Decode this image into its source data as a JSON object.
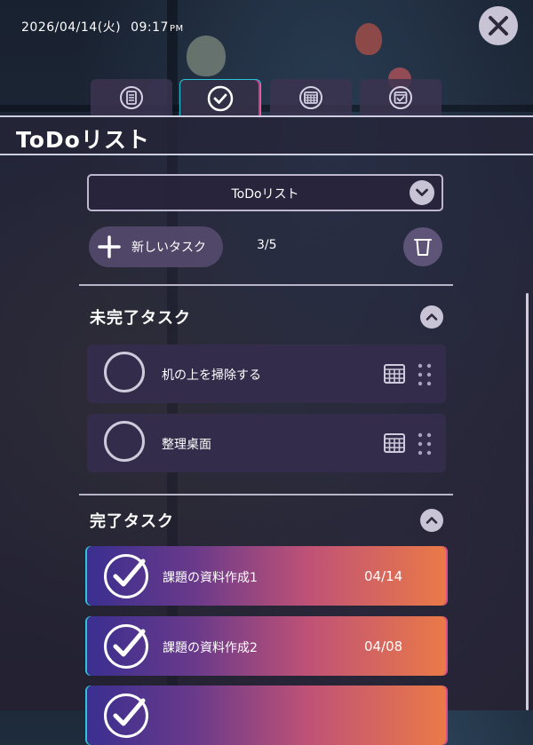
{
  "status_bar": {
    "date": "2026/04/14(火)",
    "time": "09:17",
    "meridiem": "PM"
  },
  "close_icon": "close-icon",
  "tabs": [
    {
      "icon": "list-icon",
      "active": false
    },
    {
      "icon": "check-circle-icon",
      "active": true
    },
    {
      "icon": "calendar-icon",
      "active": false
    },
    {
      "icon": "calendar-check-icon",
      "active": false
    }
  ],
  "page_title": "ToDoリスト",
  "list_selector": {
    "selected": "ToDoリスト",
    "icon": "chevron-down-icon"
  },
  "toolbar": {
    "new_task_label": "新しいタスク",
    "count": "3/5",
    "trash_icon": "trash-icon"
  },
  "incomplete": {
    "title": "未完了タスク",
    "items": [
      {
        "name": "机の上を掃除する"
      },
      {
        "name": "整理桌面"
      }
    ]
  },
  "completed": {
    "title": "完了タスク",
    "items": [
      {
        "name": "課題の資料作成1",
        "date": "04/14"
      },
      {
        "name": "課題の資料作成2",
        "date": "04/08"
      }
    ]
  },
  "colors": {
    "accent_cyan": "#28c5d9",
    "accent_pink": "#d83e8c",
    "done_gradient_start": "#3a2f90",
    "done_gradient_end": "#ea7a47"
  }
}
